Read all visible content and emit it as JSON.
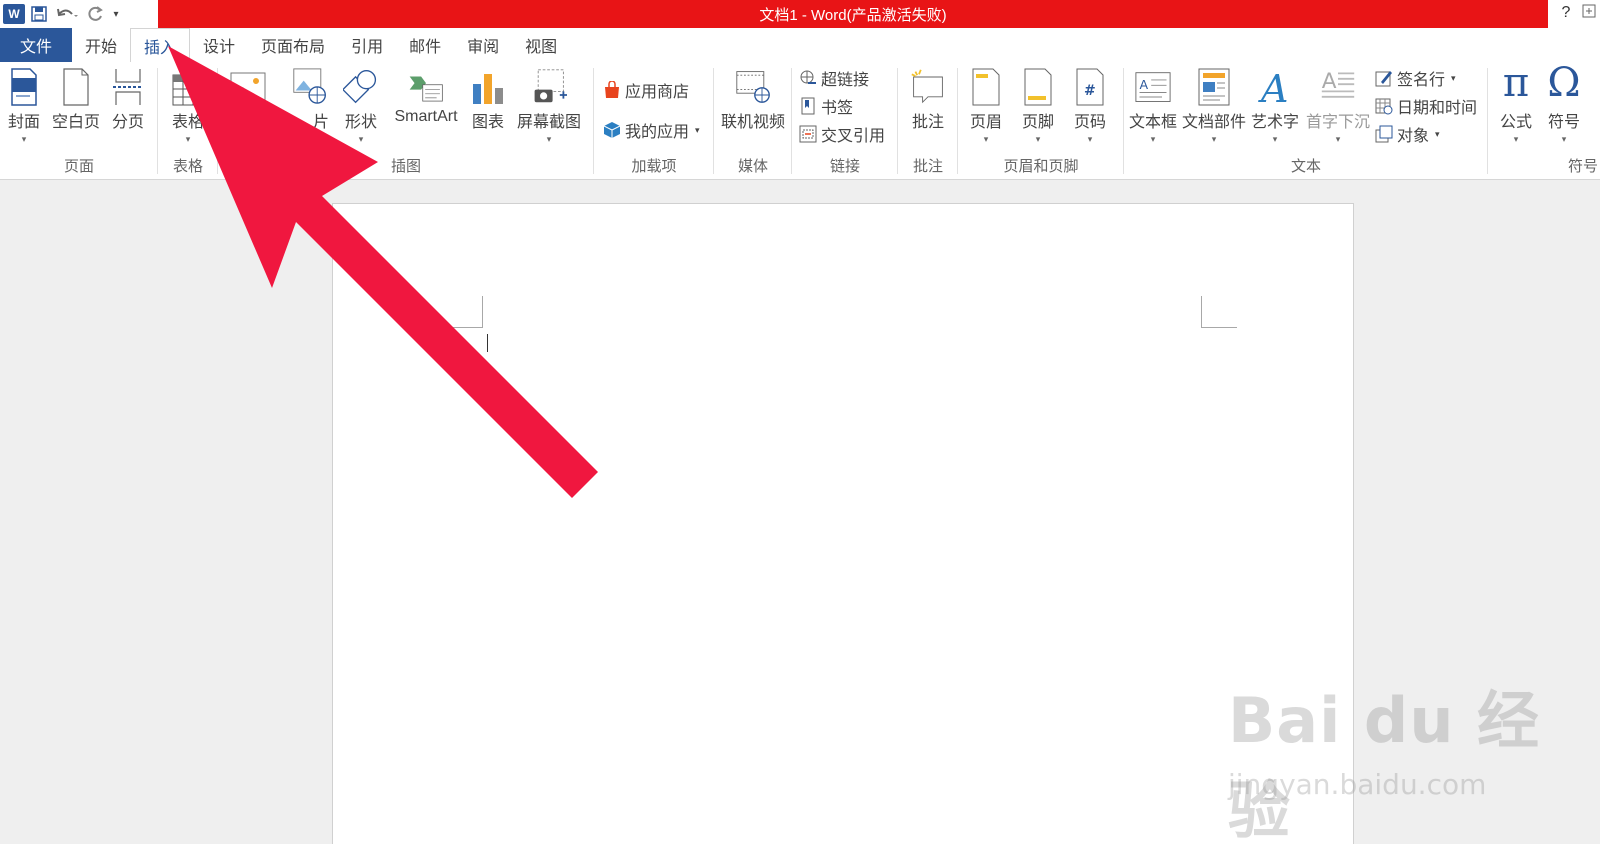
{
  "window": {
    "title": "文档1 -  Word(产品激活失败)",
    "help": "?",
    "title_bar_color": "#e81416",
    "accent": "#2b579a"
  },
  "qat": {
    "word_logo": "W",
    "icons": [
      "word-icon",
      "save-icon",
      "undo-icon",
      "redo-icon",
      "customize-qat-icon"
    ]
  },
  "tabs": [
    {
      "label": "文件"
    },
    {
      "label": "开始"
    },
    {
      "label": "插入"
    },
    {
      "label": "设计"
    },
    {
      "label": "页面布局"
    },
    {
      "label": "引用"
    },
    {
      "label": "邮件"
    },
    {
      "label": "审阅"
    },
    {
      "label": "视图"
    }
  ],
  "active_tab": "插入",
  "ribbon": {
    "pages": {
      "label": "页面",
      "cover": "封面",
      "blank": "空白页",
      "break": "分页"
    },
    "tables": {
      "label": "表格",
      "table": "表格"
    },
    "illustrations": {
      "label": "插图",
      "picture_partial": "片",
      "shapes": "形状",
      "smartart": "SmartArt",
      "chart": "图表",
      "screenshot": "屏幕截图"
    },
    "addins": {
      "label": "加载项",
      "store": "应用商店",
      "myapps": "我的应用"
    },
    "media": {
      "label": "媒体",
      "video": "联机视频"
    },
    "links": {
      "label": "链接",
      "hyperlink": "超链接",
      "bookmark": "书签",
      "crossref": "交叉引用"
    },
    "comments": {
      "label": "批注",
      "comment": "批注"
    },
    "header_footer": {
      "label": "页眉和页脚",
      "header": "页眉",
      "footer": "页脚",
      "page_number": "页码"
    },
    "text": {
      "label": "文本",
      "textbox": "文本框",
      "quickparts": "文档部件",
      "wordart": "艺术字",
      "dropcap": "首字下沉",
      "signature": "签名行",
      "datetime": "日期和时间",
      "object": "对象"
    },
    "symbols": {
      "label": "符号",
      "equation": "公式",
      "symbol": "符号",
      "equation_glyph": "π",
      "symbol_glyph": "Ω"
    }
  },
  "watermark": {
    "logo": "Bai du 经验",
    "url": "jingyan.baidu.com"
  },
  "annotation": {
    "arrow_color": "#f0173f"
  }
}
